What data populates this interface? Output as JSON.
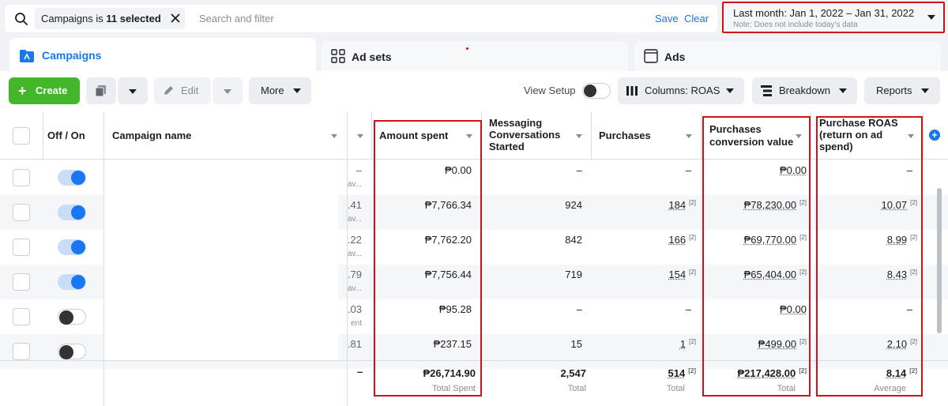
{
  "filter": {
    "chip_prefix": "Campaigns is ",
    "chip_bold": "11 selected",
    "search_placeholder": "Search and filter",
    "save": "Save",
    "clear": "Clear"
  },
  "date_range": {
    "label": "Last month: Jan 1, 2022 – Jan 31, 2022",
    "note": "Note: Does not include today's data"
  },
  "tabs": [
    {
      "label": "Campaigns",
      "active": true
    },
    {
      "label": "Ad sets",
      "active": false
    },
    {
      "label": "Ads",
      "active": false
    }
  ],
  "toolbar": {
    "create": "Create",
    "edit": "Edit",
    "more": "More",
    "view_setup": "View Setup",
    "columns": "Columns: ROAS",
    "breakdown": "Breakdown",
    "reports": "Reports"
  },
  "columns": {
    "off_on": "Off / On",
    "campaign_name": "Campaign name",
    "amount_spent": "Amount spent",
    "messaging": "Messaging Conversations Started",
    "purchases": "Purchases",
    "purchases_value": "Purchases conversion value",
    "roas": "Purchase ROAS (return on ad spend)"
  },
  "rows": [
    {
      "on": true,
      "partial_top": "–",
      "partial_bottom": "av...",
      "amount": "₱0.00",
      "messaging": "–",
      "purchases": "–",
      "value": "₱0.00",
      "roas": "–"
    },
    {
      "on": true,
      "partial_top": ".41",
      "partial_bottom": "av...",
      "amount": "₱7,766.34",
      "messaging": "924",
      "purchases": "184",
      "value": "₱78,230.00",
      "roas": "10.07"
    },
    {
      "on": true,
      "partial_top": ".22",
      "partial_bottom": "av...",
      "amount": "₱7,762.20",
      "messaging": "842",
      "purchases": "166",
      "value": "₱69,770.00",
      "roas": "8.99"
    },
    {
      "on": true,
      "partial_top": ".79",
      "partial_bottom": "av...",
      "amount": "₱7,756.44",
      "messaging": "719",
      "purchases": "154",
      "value": "₱65,404.00",
      "roas": "8.43"
    },
    {
      "on": false,
      "partial_top": ".03",
      "partial_bottom": "ent",
      "amount": "₱95.28",
      "messaging": "–",
      "purchases": "–",
      "value": "₱0.00",
      "roas": "–"
    },
    {
      "on": false,
      "partial_top": ".81",
      "partial_bottom": "",
      "amount": "₱237.15",
      "messaging": "15",
      "purchases": "1",
      "value": "₱499.00",
      "roas": "2.10"
    }
  ],
  "attribution_marker": "[2]",
  "totals": {
    "partial": "–",
    "amount": "₱26,714.90",
    "amount_label": "Total Spent",
    "messaging": "2,547",
    "messaging_label": "Total",
    "purchases": "514",
    "purchases_label": "Total",
    "value": "₱217,428.00",
    "value_label": "Total",
    "roas": "8.14",
    "roas_label": "Average"
  }
}
